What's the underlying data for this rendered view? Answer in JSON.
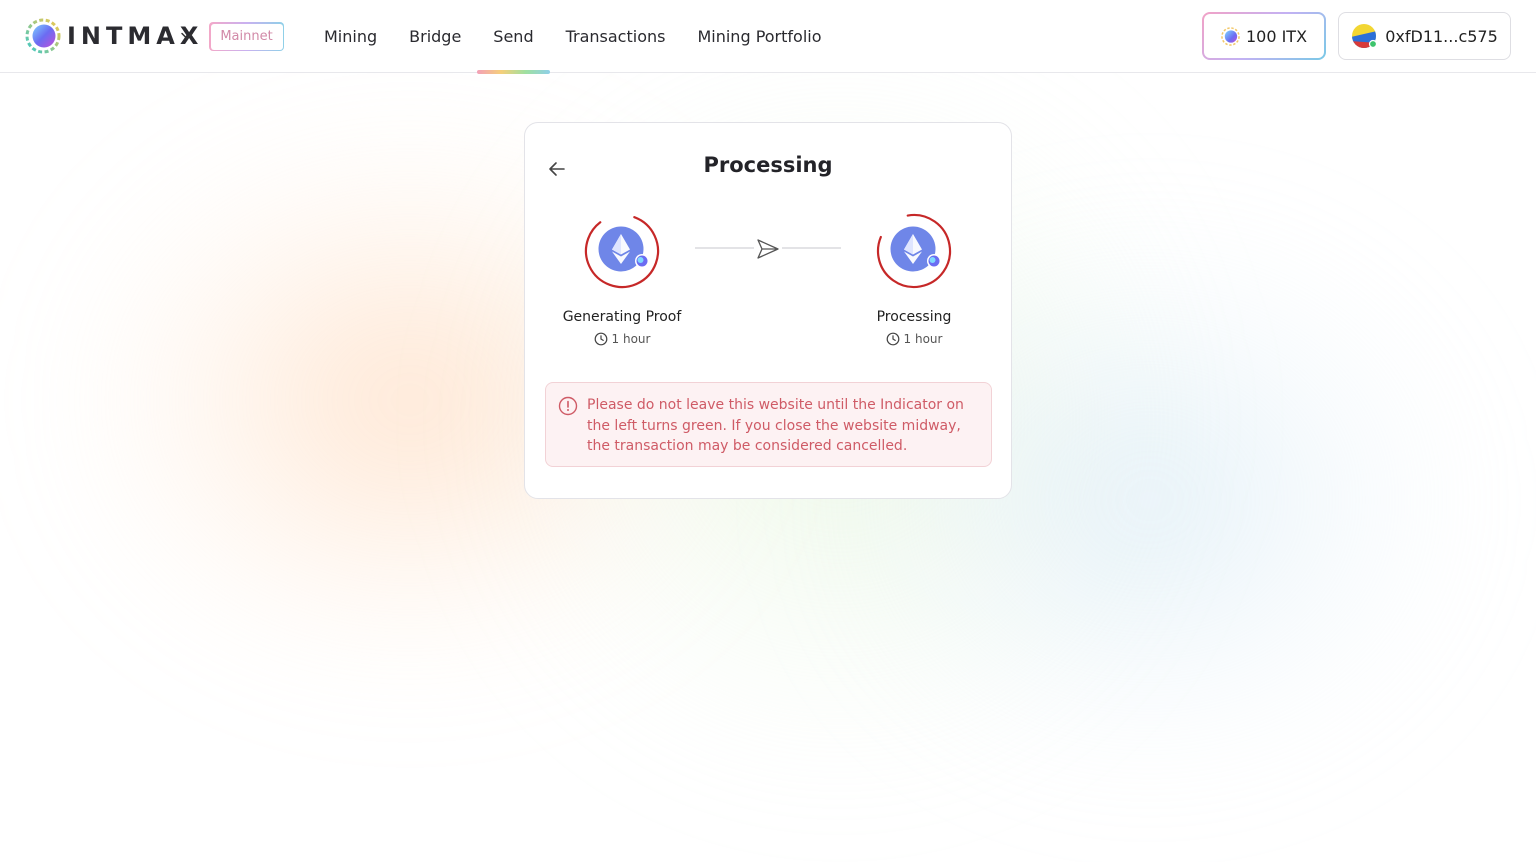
{
  "header": {
    "logo_text": "INTMAX",
    "network_badge": "Mainnet",
    "nav": [
      {
        "label": "Mining",
        "active": false
      },
      {
        "label": "Bridge",
        "active": false
      },
      {
        "label": "Send",
        "active": true
      },
      {
        "label": "Transactions",
        "active": false
      },
      {
        "label": "Mining Portfolio",
        "active": false
      }
    ],
    "balance_label": "100 ITX",
    "wallet_address": "0xfD11...c575"
  },
  "card": {
    "title": "Processing",
    "steps": [
      {
        "label": "Generating Proof",
        "time": "1 hour",
        "icon": "ethereum-icon"
      },
      {
        "label": "Processing",
        "time": "1 hour",
        "icon": "ethereum-icon"
      }
    ],
    "warning": "Please do not leave this website until the Indicator on the left turns green. If you close the website midway, the transaction may be considered cancelled."
  },
  "colors": {
    "ring_red": "#c62828",
    "eth_blue": "#6f86e8",
    "warning_text": "#cf5b66",
    "warning_bg": "#fdf2f3"
  }
}
